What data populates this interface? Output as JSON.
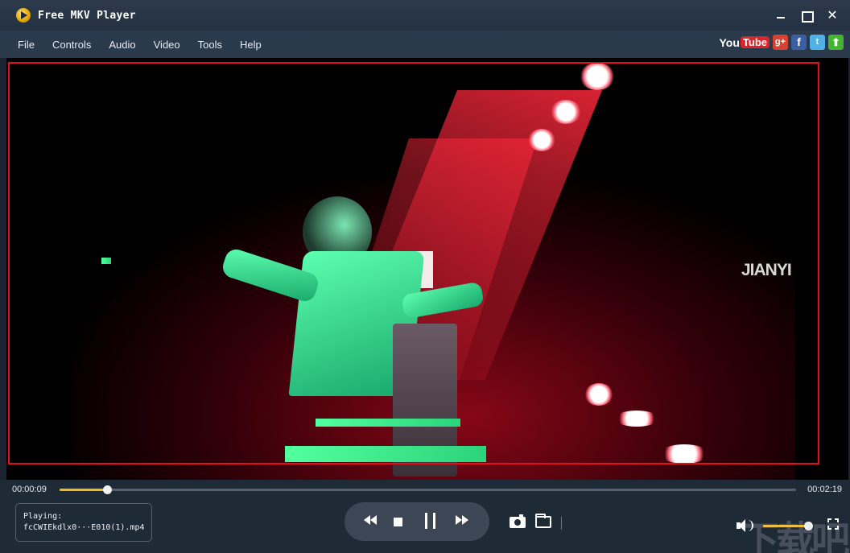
{
  "window": {
    "title": "Free MKV Player"
  },
  "menu": {
    "items": [
      "File",
      "Controls",
      "Audio",
      "Video",
      "Tools",
      "Help"
    ]
  },
  "social": {
    "youtube_you": "You",
    "youtube_tube": "Tube",
    "gplus_label": "g+",
    "facebook_label": "f",
    "twitter_label": "t",
    "upload_label": "⬆"
  },
  "video": {
    "overlay_text": "JIANYI",
    "selection_frame_color": "#e3101a"
  },
  "playback": {
    "current_time": "00:00:09",
    "total_time": "00:02:19",
    "progress_fraction": 0.065,
    "volume_fraction": 0.93
  },
  "status": {
    "label": "Playing:",
    "filename": "fcCWIEkdlx0···E010(1).mp4"
  },
  "watermark": {
    "text": "下载吧"
  },
  "colors": {
    "accent": "#f3b91b",
    "chrome": "#1f2a37",
    "title_bar": "#2c3a4c"
  }
}
